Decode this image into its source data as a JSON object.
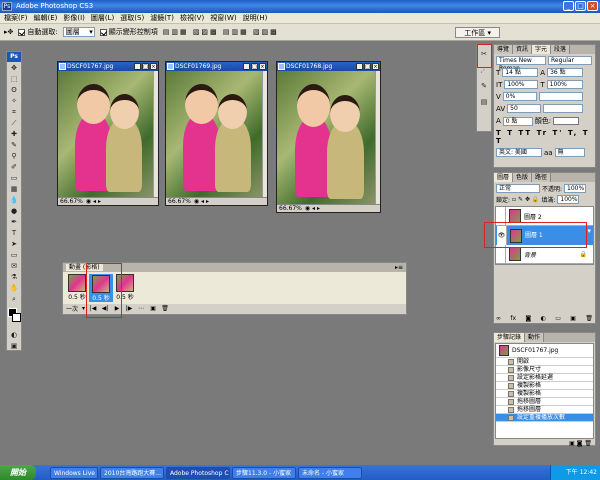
{
  "app": {
    "title": "Adobe Photoshop CS3",
    "logo": "Ps"
  },
  "menu": [
    "檔案(F)",
    "編輯(E)",
    "影像(I)",
    "圖層(L)",
    "選取(S)",
    "濾鏡(T)",
    "檢視(V)",
    "視窗(W)",
    "說明(H)"
  ],
  "options": {
    "auto_select_label": "自動選取:",
    "auto_select_value": "圖層",
    "show_transform_label": "顯示變形控制項",
    "workspace_label": "工作區 ▾"
  },
  "documents": [
    {
      "title": "DSCF01767.jpg",
      "zoom": "66.67%"
    },
    {
      "title": "DSCF01769.jpg",
      "zoom": "66.67%"
    },
    {
      "title": "DSCF01768.jpg",
      "zoom": "66.67%"
    }
  ],
  "char_panel": {
    "tabs": [
      "導覽",
      "資訊",
      "字元",
      "段落"
    ],
    "font": "Times New Roman",
    "style": "Regular",
    "size": "14 點",
    "leading": "36 點",
    "tracking_a": "100%",
    "tracking_b": "100%",
    "v1": "0%",
    "v2": "50",
    "v3": "0 點",
    "color_label": "顏色:",
    "lang": "英文: 美國",
    "aa": "無"
  },
  "layers_panel": {
    "tabs": [
      "圖層",
      "色版",
      "路徑"
    ],
    "blend": "正常",
    "opacity_label": "不透明:",
    "opacity": "100%",
    "lock_label": "鎖定:",
    "fill_label": "填滿:",
    "fill": "100%",
    "layers": [
      {
        "name": "圖層 2",
        "visible": false,
        "selected": false
      },
      {
        "name": "圖層 1",
        "visible": true,
        "selected": true
      },
      {
        "name": "背景",
        "visible": false,
        "selected": false
      }
    ]
  },
  "history_panel": {
    "tabs": [
      "步驟記錄",
      "動作"
    ],
    "snapshot": "DSCF01767.jpg",
    "steps": [
      "開啟",
      "影像尺寸",
      "設定影格延遲",
      "複製影格",
      "複製影格",
      "拖移圖層",
      "拖移圖層",
      "設定重複播放次數"
    ]
  },
  "animation": {
    "title": "動畫 (影格)",
    "frames": [
      {
        "num": "1",
        "delay": "0.5 秒"
      },
      {
        "num": "2",
        "delay": "0.5 秒"
      },
      {
        "num": "3",
        "delay": "0.5 秒"
      }
    ],
    "loop": "一次"
  },
  "taskbar": {
    "start": "開始",
    "tasks": [
      "Windows Live Messenger",
      "2010台灣路跑大賽...",
      "Adobe Photoshop CS3",
      "步驟11.3.0 - 小蜜家",
      "未命名 - 小蜜家"
    ],
    "clock": "下午 12:42"
  }
}
